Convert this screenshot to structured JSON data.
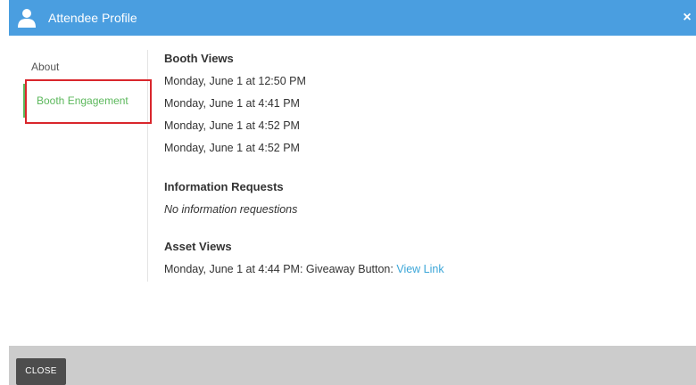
{
  "header": {
    "title": "Attendee Profile",
    "close_glyph": "×",
    "icon": "user-icon",
    "background": "#4a9ee0"
  },
  "sidebar": {
    "items": [
      {
        "label": "About",
        "active": false
      },
      {
        "label": "Booth Engagement",
        "active": true
      }
    ],
    "active_color": "#5cb85c",
    "highlight_color": "#d9262c"
  },
  "content": {
    "booth_views": {
      "title": "Booth Views",
      "entries": [
        "Monday, June 1 at 12:50 PM",
        "Monday, June 1 at 4:41 PM",
        "Monday, June 1 at 4:52 PM",
        "Monday, June 1 at 4:52 PM"
      ]
    },
    "information_requests": {
      "title": "Information Requests",
      "empty_text": "No information requestions"
    },
    "asset_views": {
      "title": "Asset Views",
      "entries": [
        {
          "text": "Monday, June 1 at 4:44 PM: Giveaway Button: ",
          "link": "View Link"
        }
      ],
      "link_color": "#3ba6d8"
    }
  },
  "footer": {
    "close_label": "CLOSE"
  }
}
